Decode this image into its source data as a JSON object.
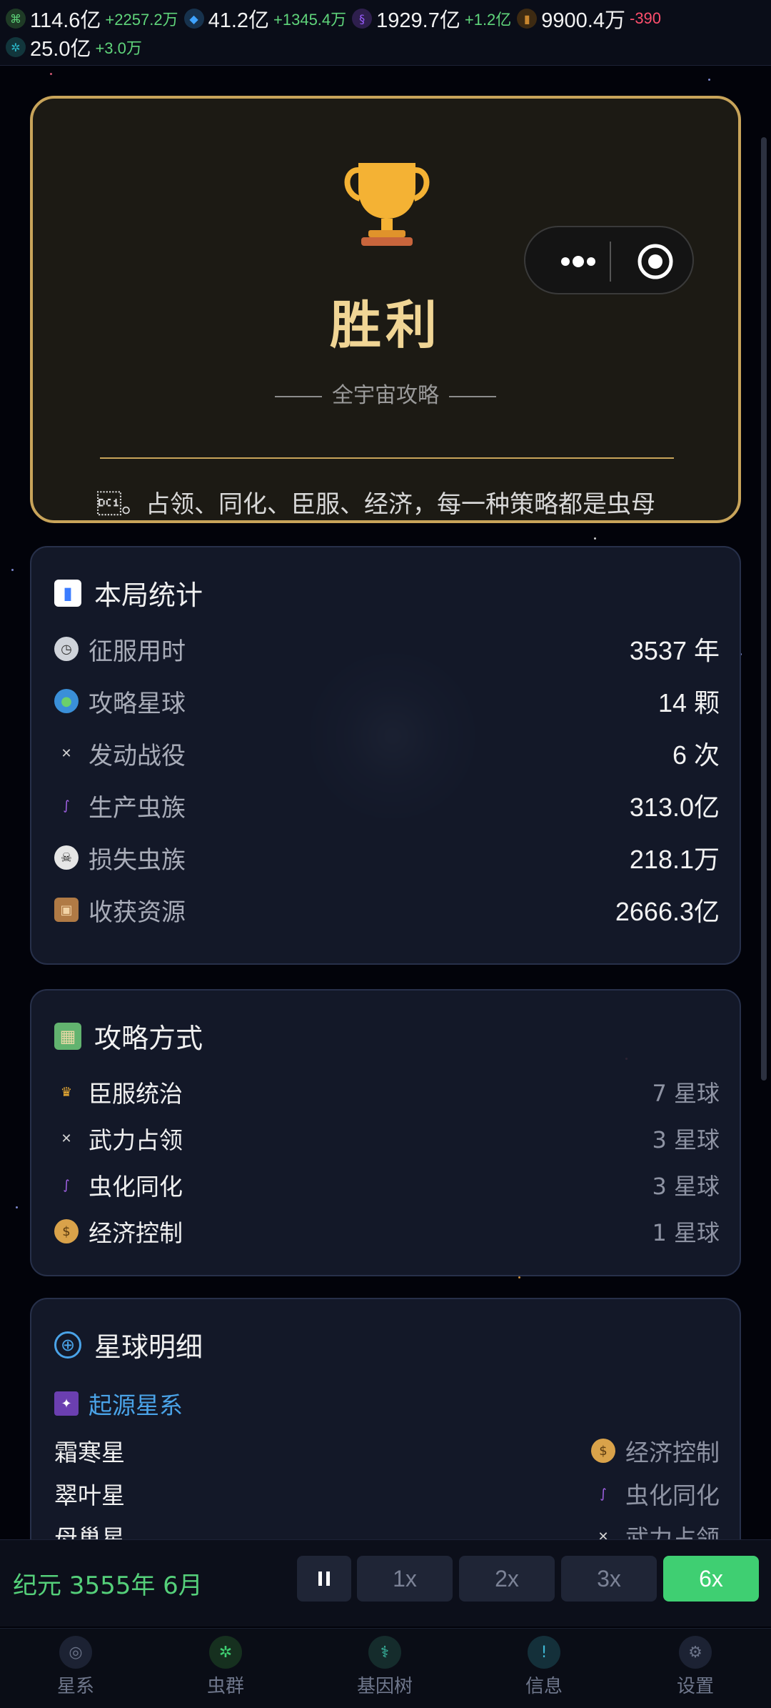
{
  "resources": [
    {
      "icon": "dna-icon",
      "value": "114.6亿",
      "delta": "+2257.2万",
      "color": "#5fd47a",
      "positive": true
    },
    {
      "icon": "crystal-icon",
      "value": "41.2亿",
      "delta": "+1345.4万",
      "color": "#3fa3ff",
      "positive": true
    },
    {
      "icon": "energy-icon",
      "value": "1929.7亿",
      "delta": "+1.2亿",
      "color": "#9a5cff",
      "positive": true
    },
    {
      "icon": "gold-icon",
      "value": "9900.4万",
      "delta": "-390",
      "color": "#c8862f",
      "positive": false
    },
    {
      "icon": "gear-icon",
      "value": "25.0亿",
      "delta": "+3.0万",
      "color": "#2ab7c9",
      "positive": true
    }
  ],
  "victory": {
    "title": "胜利",
    "subtitle": "全宇宙攻略",
    "description": "\u0011。占领、同化、臣服、经济，每一种策略都是虫母",
    "trophy_icon": "trophy-icon",
    "colors": {
      "gold": "#c8a45a"
    }
  },
  "stats": {
    "title": "本局统计",
    "title_icon": "bar-chart-icon",
    "rows": [
      {
        "icon": "stopwatch-icon",
        "label": "征服用时",
        "value": "3537 年"
      },
      {
        "icon": "globe-icon",
        "label": "攻略星球",
        "value": "14 颗"
      },
      {
        "icon": "crossed-swords-icon",
        "label": "发动战役",
        "value": "6 次"
      },
      {
        "icon": "worm-icon",
        "label": "生产虫族",
        "value": "313.0亿"
      },
      {
        "icon": "skull-icon",
        "label": "损失虫族",
        "value": "218.1万"
      },
      {
        "icon": "package-icon",
        "label": "收获资源",
        "value": "2666.3亿"
      }
    ]
  },
  "methods": {
    "title": "攻略方式",
    "title_icon": "map-icon",
    "rows": [
      {
        "icon": "crown-icon",
        "label": "臣服统治",
        "value": "7 星球"
      },
      {
        "icon": "crossed-swords-icon",
        "label": "武力占领",
        "value": "3 星球"
      },
      {
        "icon": "worm-icon",
        "label": "虫化同化",
        "value": "3 星球"
      },
      {
        "icon": "money-bag-icon",
        "label": "经济控制",
        "value": "1 星球"
      }
    ]
  },
  "planets": {
    "title": "星球明细",
    "title_icon": "globe-grid-icon",
    "system": {
      "name": "起源星系",
      "icon": "galaxy-icon"
    },
    "rows": [
      {
        "name": "霜寒星",
        "icon": "money-bag-icon",
        "type": "经济控制"
      },
      {
        "name": "翠叶星",
        "icon": "worm-icon",
        "type": "虫化同化"
      },
      {
        "name": "母巢星",
        "icon": "crossed-swords-icon",
        "type": "武力占领"
      }
    ]
  },
  "controls": {
    "era": "纪元 3555年 6月",
    "pause_icon": "pause-icon",
    "speeds": [
      "1x",
      "2x",
      "3x",
      "6x"
    ],
    "active_speed": "6x"
  },
  "nav": [
    {
      "label": "星系",
      "icon": "planet-icon"
    },
    {
      "label": "虫群",
      "icon": "bug-icon"
    },
    {
      "label": "基因树",
      "icon": "gene-icon"
    },
    {
      "label": "信息",
      "icon": "info-icon"
    },
    {
      "label": "设置",
      "icon": "gear-icon"
    }
  ]
}
